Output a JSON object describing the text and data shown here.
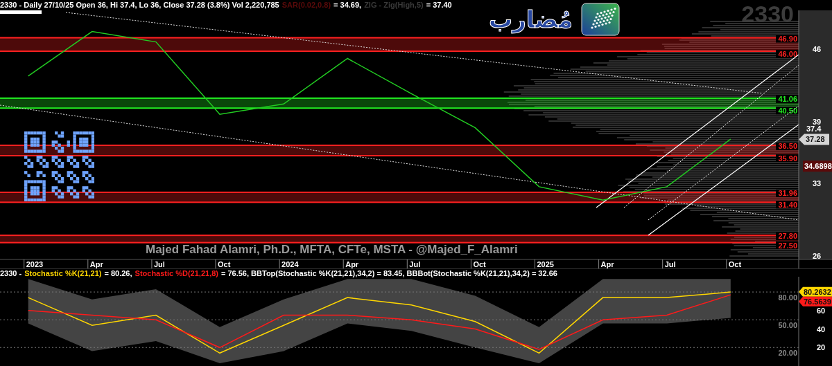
{
  "header": {
    "segments": [
      {
        "text": "2330 - Daily 27/10/25 Open 36, Hi 37.4, Lo 36, Close 37.28 (3.8%) Vol 2,220,785",
        "color": "#ffffff"
      },
      {
        "text": "SAR(0.02,0.8)",
        "color": "#5a0a0a"
      },
      {
        "text": "= 34.69,",
        "color": "#ffffff"
      },
      {
        "text": "ZIG - Zig(High,5)",
        "color": "#3a3a3a"
      },
      {
        "text": "= 37.40",
        "color": "#ffffff"
      }
    ]
  },
  "symbol": "2330",
  "logo": {
    "text": "مُضارب"
  },
  "signature": "Majed Fahad Alamri, Ph.D., MFTA, CFTe, MSTA - @Majed_F_Alamri",
  "price_chart": {
    "chart_data": {
      "type": "line",
      "categories": [
        "2023",
        "Apr",
        "Jul",
        "Oct",
        "2024",
        "Apr",
        "Jul",
        "Oct",
        "2025",
        "Apr",
        "Jul",
        "Oct"
      ],
      "series": [
        {
          "color": "#22cc22",
          "values": [
            43.4,
            47.7,
            46.7,
            39.7,
            40.7,
            45.1,
            41.7,
            38.4,
            32.7,
            31.4,
            32.7,
            37.3
          ]
        }
      ],
      "ylim": [
        25.67,
        50.75
      ],
      "yticks": [
        26,
        33,
        39,
        46
      ]
    },
    "zones": [
      {
        "upper": "46.90",
        "lower": "46.00",
        "color": "#ff2020"
      },
      {
        "upper": "41.06",
        "lower": "40.50",
        "color": "#22ee22"
      },
      {
        "upper": "36.50",
        "lower": "35.90",
        "color": "#ff2020"
      },
      {
        "upper": "31.96",
        "lower": "31.40",
        "color": "#ff2020"
      },
      {
        "upper": "27.80",
        "lower": "27.50",
        "color": "#ff2020"
      }
    ],
    "price_labels": [
      {
        "kind": "high",
        "text": "37.4"
      },
      {
        "kind": "last",
        "text": "37.28"
      },
      {
        "kind": "sar",
        "text": "34.6898"
      }
    ]
  },
  "stochastic": {
    "legend": [
      {
        "text": "2330 -",
        "color": "#ffffff"
      },
      {
        "text": "Stochastic %K(21,21)",
        "color": "#ffd700"
      },
      {
        "text": "= 80.26,",
        "color": "#ffffff"
      },
      {
        "text": "Stochastic %D(21,21,8)",
        "color": "#ff1a1a"
      },
      {
        "text": "= 76.56, BBTop(Stochastic %K(21,21),34,2) = 83.45, BBBot(Stochastic %K(21,21),34,2) = 32.66",
        "color": "#ffffff"
      }
    ],
    "chart_data": {
      "type": "line",
      "series": [
        {
          "color": "#ffd700",
          "values": [
            74,
            44,
            55,
            14,
            44,
            74,
            66,
            48,
            14,
            74,
            74,
            80
          ]
        },
        {
          "color": "#ff1a1a",
          "values": [
            60,
            55,
            50,
            20,
            55,
            55,
            50,
            40,
            18,
            50,
            55,
            77
          ]
        }
      ],
      "ylim": [
        0,
        96.5
      ],
      "yticks": [
        20,
        40,
        60
      ]
    },
    "gridlines": [
      "80.00",
      "50.00",
      "20.00"
    ],
    "tags": [
      {
        "kind": "k",
        "text": "80.2632"
      },
      {
        "kind": "d",
        "text": "76.5639"
      }
    ]
  }
}
